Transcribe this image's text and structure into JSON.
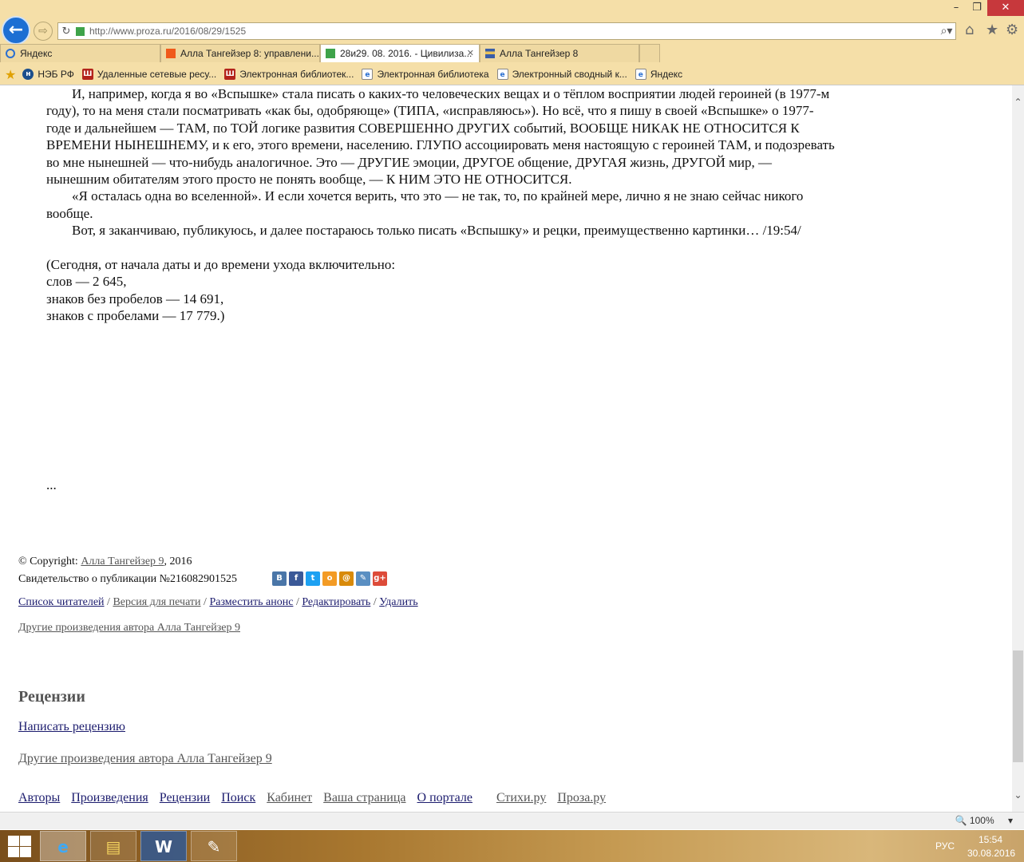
{
  "browser": {
    "url": "http://www.proza.ru/2016/08/29/1525",
    "tabs": [
      {
        "label": "Яндекс",
        "favicon_color": "#2a6fd1",
        "active": false
      },
      {
        "label": "Алла Тангейзер 8: управлени...",
        "favicon_color": "#f05a1a",
        "active": false
      },
      {
        "label": "28и29. 08. 2016. - Цивилиза...",
        "favicon_color": "#3ea34a",
        "active": true
      },
      {
        "label": "Алла Тангейзер 8",
        "favicon_color": "#3a5ea8",
        "active": false
      }
    ],
    "favorites": [
      {
        "label": "НЭБ РФ",
        "icon": "neb-icon"
      },
      {
        "label": "Удаленные сетевые ресу...",
        "icon": "library-icon"
      },
      {
        "label": "Электронная библиотек...",
        "icon": "library-icon"
      },
      {
        "label": "Электронная библиотека",
        "icon": "page-icon"
      },
      {
        "label": "Электронный сводный к...",
        "icon": "page-icon"
      },
      {
        "label": "Яндекс",
        "icon": "page-icon"
      }
    ],
    "zoom": "100%"
  },
  "article": {
    "paragraphs": [
      "И, например, когда я во «Вспышке» стала писать о каких-то человеческих вещах и о тёплом восприятии людей героиней (в 1977-м году), то на меня стали посматривать «как бы, одобряюще» (ТИПА, «исправляюсь»). Но всё, что я пишу в своей «Вспышке» о 1977-годе и дальнейшем — ТАМ, по ТОЙ логике развития СОВЕРШЕННО ДРУГИХ событий, ВООБЩЕ НИКАК НЕ ОТНОСИТСЯ К ВРЕМЕНИ НЫНЕШНЕМУ, и к его, этого времени, населению. ГЛУПО ассоциировать меня настоящую с героиней ТАМ, и подозревать во мне нынешней — что-нибудь аналогичное. Это — ДРУГИЕ эмоции, ДРУГОЕ общение, ДРУГАЯ жизнь, ДРУГОЙ мир, — нынешним обитателям этого просто не понять вообще, — К НИМ ЭТО НЕ ОТНОСИТСЯ.",
      "«Я осталась одна во вселенной». И если хочется верить, что это — не так, то, по крайней мере, лично я не знаю сейчас никого вообще.",
      "Вот, я заканчиваю, публикуюсь, и далее постараюсь только писать «Вспышку» и рецки, преимущественно картинки… /19:54/"
    ],
    "stats": [
      "(Сегодня, от начала даты и до времени ухода включительно:",
      "слов — 2 645,",
      "знаков без пробелов — 14 691,",
      "знаков с пробелами — 17 779.)"
    ],
    "ellipsis": "..."
  },
  "footer": {
    "copyright_prefix": "© Copyright: ",
    "author_link": "Алла Тангейзер 9",
    "copyright_year": ", 2016",
    "certificate": "Свидетельство о публикации №216082901525",
    "share": [
      {
        "icon": "vk-icon",
        "glyph": "В",
        "color": "#4a76a8"
      },
      {
        "icon": "facebook-icon",
        "glyph": "f",
        "color": "#3b5998"
      },
      {
        "icon": "twitter-icon",
        "glyph": "t",
        "color": "#1da1f2"
      },
      {
        "icon": "odnoklassniki-icon",
        "glyph": "о",
        "color": "#f39b25"
      },
      {
        "icon": "mailru-icon",
        "glyph": "@",
        "color": "#d88a0a"
      },
      {
        "icon": "livejournal-icon",
        "glyph": "✎",
        "color": "#5a8fc2"
      },
      {
        "icon": "googleplus-icon",
        "glyph": "g+",
        "color": "#dd4b39"
      }
    ],
    "actions": {
      "readers": "Список читателей",
      "print": "Версия для печати",
      "announce": "Разместить анонс",
      "edit": "Редактировать",
      "delete": "Удалить",
      "sep": " / "
    },
    "other_works": "Другие произведения автора Алла Тангейзер 9"
  },
  "reviews": {
    "heading": "Рецензии",
    "write": "Написать рецензию",
    "other_works": "Другие произведения автора Алла Тангейзер 9"
  },
  "bottom_nav": {
    "authors": "Авторы",
    "works": "Произведения",
    "reviews": "Рецензии",
    "search": "Поиск",
    "cabinet": "Кабинет",
    "your_page": "Ваша страница",
    "about": "О портале",
    "stihi": "Стихи.ру",
    "proza": "Проза.ру"
  },
  "taskbar": {
    "apps": [
      {
        "name": "internet-explorer",
        "glyph": "e",
        "active": true
      },
      {
        "name": "file-explorer",
        "glyph": "▤",
        "active": false
      },
      {
        "name": "word",
        "glyph": "W",
        "active": false
      },
      {
        "name": "paint",
        "glyph": "✎",
        "active": false
      }
    ],
    "lang": "РУС",
    "time": "15:54",
    "date": "30.08.2016"
  }
}
